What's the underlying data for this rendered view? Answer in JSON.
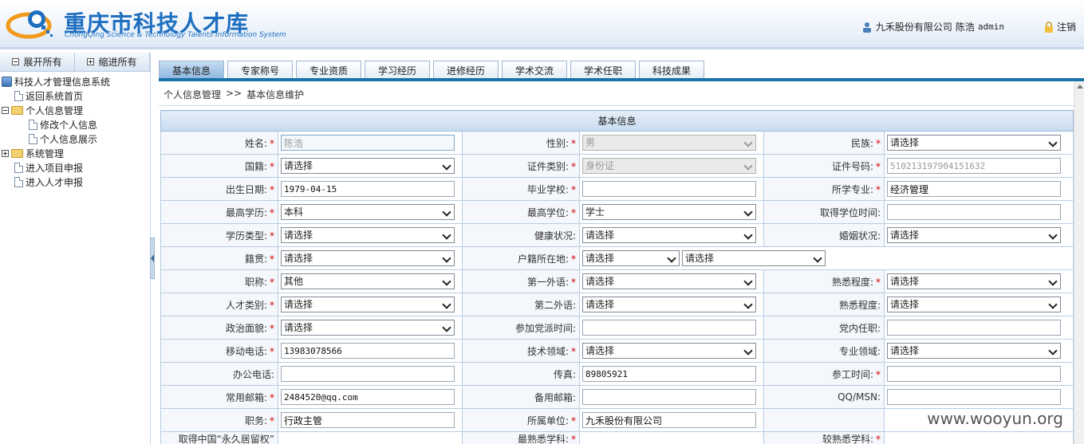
{
  "header": {
    "logo_cn": "重庆市科技人才库",
    "logo_en": "ChongQing Science & Technology Talents Information System",
    "company": "九禾股份有限公司",
    "user_name": "陈浩",
    "user_id": "admin",
    "logout": "注销"
  },
  "left": {
    "expand_all": "展开所有",
    "collapse_all": "缩进所有",
    "tree": [
      {
        "label": "科技人才管理信息系统"
      },
      {
        "label": "返回系统首页"
      },
      {
        "label": "个人信息管理"
      },
      {
        "label": "修改个人信息"
      },
      {
        "label": "个人信息展示"
      },
      {
        "label": "系统管理"
      },
      {
        "label": "进入项目申报"
      },
      {
        "label": "进入人才申报"
      }
    ]
  },
  "tabs": [
    "基本信息",
    "专家称号",
    "专业资质",
    "学习经历",
    "进修经历",
    "学术交流",
    "学术任职",
    "科技成果"
  ],
  "breadcrumb": {
    "a": "个人信息管理",
    "sep": ">>",
    "b": "基本信息维护"
  },
  "form": {
    "title": "基本信息",
    "name_label": "姓名:",
    "name_value": "陈浩",
    "gender_label": "性别:",
    "gender_value": "男",
    "ethnic_label": "民族:",
    "ethnic_value": "请选择",
    "nationality_label": "国籍:",
    "nationality_value": "请选择",
    "idtype_label": "证件类别:",
    "idtype_value": "身份证",
    "idno_label": "证件号码:",
    "idno_value": "510213197904151632",
    "birth_label": "出生日期:",
    "birth_value": "1979-04-15",
    "school_label": "毕业学校:",
    "school_value": "",
    "major_label": "所学专业:",
    "major_value": "经济管理",
    "edu_label": "最高学历:",
    "edu_value": "本科",
    "degree_label": "最高学位:",
    "degree_value": "学士",
    "degree_time_label": "取得学位时间:",
    "degree_time_value": "",
    "edutype_label": "学历类型:",
    "edutype_value": "请选择",
    "health_label": "健康状况:",
    "health_value": "请选择",
    "marital_label": "婚姻状况:",
    "marital_value": "请选择",
    "native_label": "籍贯:",
    "native_value": "请选择",
    "huji_label": "户籍所在地:",
    "huji_value1": "请选择",
    "huji_value2": "请选择",
    "title_label": "职称:",
    "title_value": "其他",
    "lang1_label": "第一外语:",
    "lang1_value": "请选择",
    "prof1_label": "熟悉程度:",
    "prof1_value": "请选择",
    "talent_label": "人才类别:",
    "talent_value": "请选择",
    "lang2_label": "第二外语:",
    "lang2_value": "请选择",
    "prof2_label": "熟悉程度:",
    "prof2_value": "请选择",
    "political_label": "政治面貌:",
    "political_value": "请选择",
    "party_time_label": "参加党派时间:",
    "party_time_value": "",
    "party_post_label": "党内任职:",
    "party_post_value": "",
    "mobile_label": "移动电话:",
    "mobile_value": "13983078566",
    "tech_label": "技术领域:",
    "tech_value": "请选择",
    "field_label": "专业领域:",
    "field_value": "请选择",
    "office_label": "办公电话:",
    "office_value": "",
    "fax_label": "传真:",
    "fax_value": "89805921",
    "worktime_label": "参工时间:",
    "worktime_value": "",
    "email_label": "常用邮箱:",
    "email_value": "2484520@qq.com",
    "email2_label": "备用邮箱:",
    "email2_value": "",
    "qq_label": "QQ/MSN:",
    "qq_value": "",
    "duty_label": "职务:",
    "duty_value": "行政主管",
    "unit_label": "所属单位:",
    "unit_value": "九禾股份有限公司",
    "pr_label": "取得中国“永久居留权”",
    "familiar_label": "最熟悉学科:",
    "familiar2_label": "较熟悉学科:"
  },
  "watermark": "www.wooyun.org"
}
